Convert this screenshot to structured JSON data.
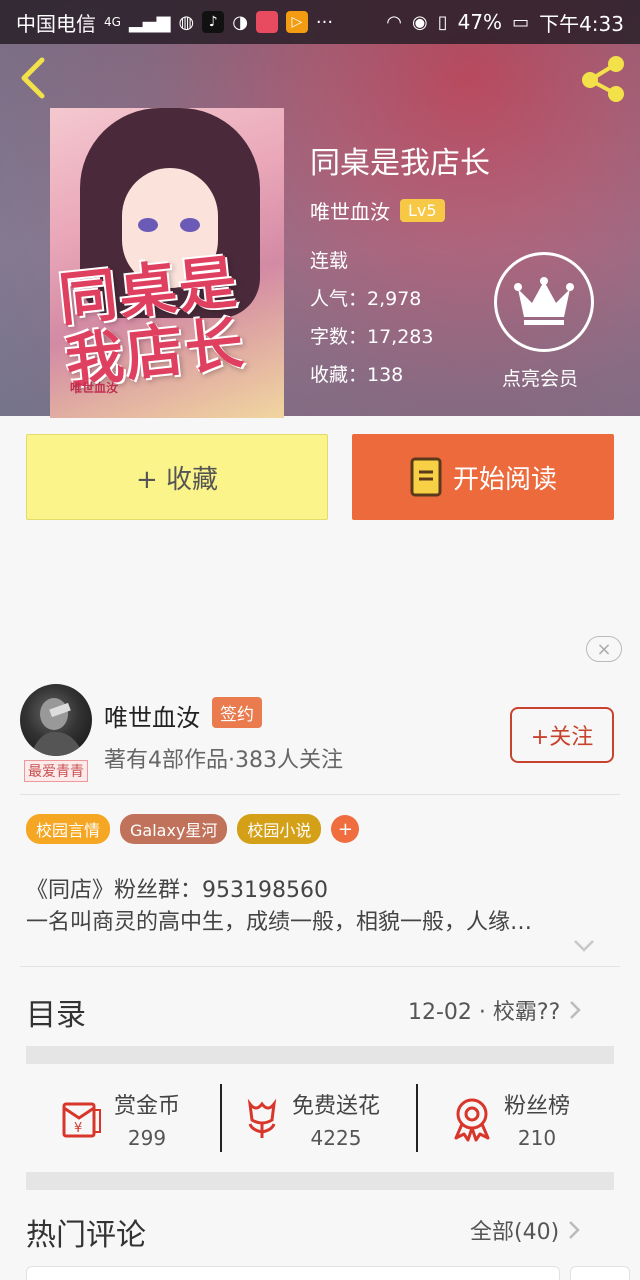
{
  "statusbar": {
    "carrier": "中国电信",
    "network": "4G",
    "battery": "47%",
    "time": "下午4:33"
  },
  "book": {
    "title": "同桌是我店长",
    "author": "唯世血汝",
    "level": "Lv5",
    "status": "连载",
    "popularity": "人气：2,978",
    "word_count": "字数：17,283",
    "favorites": "收藏：138",
    "cover_art_text": "同桌是我店长",
    "cover_sub_text": "唯世血汝"
  },
  "vip": {
    "label": "点亮会员"
  },
  "actions": {
    "collect_label": "+ 收藏",
    "read_label": "开始阅读"
  },
  "ad": {
    "close_glyph": "×"
  },
  "author_card": {
    "name": "唯世血汝",
    "sign_badge": "签约",
    "stats": "著有4部作品·383人关注",
    "follow_label": "+关注",
    "avatar_tag": "最爱青青"
  },
  "tags": {
    "items": [
      {
        "label": "校园言情",
        "color": "#f5a623"
      },
      {
        "label": "Galaxy星河",
        "color": "#c0735a"
      },
      {
        "label": "校园小说",
        "color": "#d4a017"
      }
    ],
    "plus": "+"
  },
  "description": {
    "line1": "《同店》粉丝群：953198560",
    "line2": "一名叫商灵的高中生，成绩一般，相貌一般，人缘…"
  },
  "toc": {
    "title": "目录",
    "latest": "12-02 · 校霸??"
  },
  "stats": {
    "reward": {
      "label": "赏金币",
      "value": "299"
    },
    "flower": {
      "label": "免费送花",
      "value": "4225"
    },
    "fans": {
      "label": "粉丝榜",
      "value": "210"
    }
  },
  "comments": {
    "title": "热门评论",
    "all": "全部(40)"
  },
  "colors": {
    "accent_orange": "#ec6a3c",
    "collect_yellow": "#fbf48a",
    "lv_badge": "#f7c845",
    "follow_red": "#c8432e",
    "icon_red": "#d9362b"
  }
}
